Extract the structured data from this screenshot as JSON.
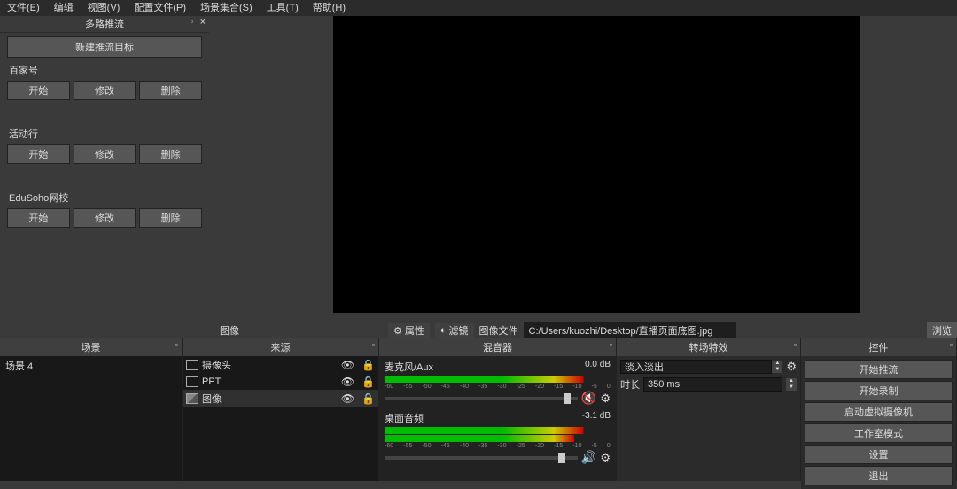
{
  "menu": [
    "文件(E)",
    "编辑",
    "视图(V)",
    "配置文件(P)",
    "场景集合(S)",
    "工具(T)",
    "帮助(H)"
  ],
  "dock": {
    "title": "多路推流",
    "new_target": "新建推流目标"
  },
  "targets": [
    {
      "name": "百家号",
      "start": "开始",
      "edit": "修改",
      "del": "删除"
    },
    {
      "name": "活动行",
      "start": "开始",
      "edit": "修改",
      "del": "删除"
    },
    {
      "name": "EduSoho网校",
      "start": "开始",
      "edit": "修改",
      "del": "删除"
    }
  ],
  "hbar": {
    "tab": "图像",
    "props": "属性",
    "filters": "滤镜",
    "file_label": "图像文件",
    "path": "C:/Users/kuozhi/Desktop/直播页面底图.jpg",
    "browse": "浏览"
  },
  "scenes": {
    "title": "场景",
    "items": [
      "场景 4"
    ]
  },
  "sources": {
    "title": "来源",
    "items": [
      {
        "name": "摄像头"
      },
      {
        "name": "PPT"
      },
      {
        "name": "图像"
      }
    ]
  },
  "mixer": {
    "title": "混音器",
    "channels": [
      {
        "name": "麦克风/Aux",
        "db": "0.0 dB",
        "muted": true
      },
      {
        "name": "桌面音频",
        "db": "-3.1 dB",
        "muted": false
      }
    ],
    "ticks": [
      "-60",
      "-55",
      "-50",
      "-45",
      "-40",
      "-35",
      "-30",
      "-25",
      "-20",
      "-15",
      "-10",
      "-5",
      "0"
    ]
  },
  "trans": {
    "title": "转场特效",
    "mode": "淡入淡出",
    "dur_label": "时长",
    "dur": "350 ms"
  },
  "controls": {
    "title": "控件",
    "buttons": [
      "开始推流",
      "开始录制",
      "启动虚拟摄像机",
      "工作室模式",
      "设置",
      "退出"
    ]
  }
}
